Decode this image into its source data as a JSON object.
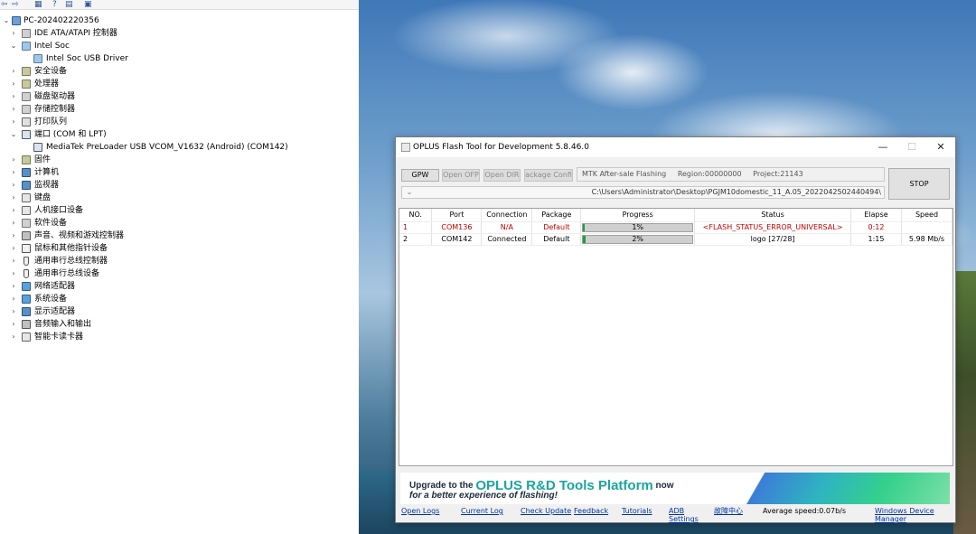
{
  "device_manager": {
    "toolbar": {
      "back": "⇦",
      "forward": "⇨",
      "view_a": "▦",
      "help": "?",
      "view_b": "▤",
      "monitor": "▣"
    },
    "tree": [
      {
        "label": "PC-202402220356",
        "icon": "computer-icon",
        "expanded": true
      },
      {
        "label": "IDE ATA/ATAPI 控制器",
        "icon": "ide-icon"
      },
      {
        "label": "Intel Soc",
        "icon": "usb-icon",
        "expanded": true
      },
      {
        "label": "Intel Soc USB Driver",
        "icon": "usb-driver-icon"
      },
      {
        "label": "安全设备",
        "icon": "security-device-icon"
      },
      {
        "label": "处理器",
        "icon": "processor-icon"
      },
      {
        "label": "磁盘驱动器",
        "icon": "disk-icon"
      },
      {
        "label": "存储控制器",
        "icon": "storage-controller-icon"
      },
      {
        "label": "打印队列",
        "icon": "printer-icon"
      },
      {
        "label": "端口 (COM 和 LPT)",
        "icon": "port-icon",
        "expanded": true
      },
      {
        "label": "MediaTek PreLoader USB VCOM_V1632 (Android) (COM142)",
        "icon": "port-device-icon"
      },
      {
        "label": "固件",
        "icon": "firmware-icon"
      },
      {
        "label": "计算机",
        "icon": "computer-icon"
      },
      {
        "label": "监视器",
        "icon": "monitor-icon"
      },
      {
        "label": "键盘",
        "icon": "keyboard-icon"
      },
      {
        "label": "人机接口设备",
        "icon": "hid-icon"
      },
      {
        "label": "软件设备",
        "icon": "software-device-icon"
      },
      {
        "label": "声音、视频和游戏控制器",
        "icon": "sound-icon"
      },
      {
        "label": "鼠标和其他指针设备",
        "icon": "mouse-icon"
      },
      {
        "label": "通用串行总线控制器",
        "icon": "usb-controller-icon"
      },
      {
        "label": "通用串行总线设备",
        "icon": "usb-device-icon"
      },
      {
        "label": "网络适配器",
        "icon": "network-adapter-icon"
      },
      {
        "label": "系统设备",
        "icon": "system-device-icon"
      },
      {
        "label": "显示适配器",
        "icon": "display-adapter-icon"
      },
      {
        "label": "音频输入和输出",
        "icon": "audio-io-icon"
      },
      {
        "label": "智能卡读卡器",
        "icon": "smartcard-reader-icon"
      }
    ]
  },
  "flash_tool": {
    "title": "OPLUS Flash Tool for Development 5.8.46.0",
    "window_controls": {
      "minimize": "—",
      "maximize": "☐",
      "close": "✕"
    },
    "buttons": {
      "gpw": "GPW",
      "open_ofp": "Open OFP",
      "open_dir": "Open DIR",
      "package_config": "ackage Confi",
      "stop": "STOP"
    },
    "info": {
      "mode": "MTK After-sale Flashing",
      "region": "Region:00000000",
      "project": "Project:21143"
    },
    "path": "C:\\Users\\Administrator\\Desktop\\PGJM10domestic_11_A.05_2022042502440494\\",
    "table": {
      "headers": [
        "NO.",
        "Port",
        "Connection",
        "Package",
        "Progress",
        "Status",
        "Elapse",
        "Speed"
      ],
      "rows": [
        {
          "no": "1",
          "port": "COM136",
          "connection": "N/A",
          "package": "Default",
          "progress_label": "1%",
          "progress": 1,
          "status": "<FLASH_STATUS_ERROR_UNIVERSAL>",
          "elapse": "0:12",
          "speed": "",
          "error": true
        },
        {
          "no": "2",
          "port": "COM142",
          "connection": "Connected",
          "package": "Default",
          "progress_label": "2%",
          "progress": 2,
          "status": "logo [27/28]",
          "elapse": "1:15",
          "speed": "5.98 Mb/s",
          "error": false
        }
      ]
    },
    "banner": {
      "prefix": "Upgrade to the ",
      "brand": "OPLUS R&D Tools Platform",
      "suffix": " now",
      "line2": "for a better experience of flashing!"
    },
    "footer": {
      "open_logs": "Open Logs",
      "current_log": "Current Log",
      "check_update": "Check Update",
      "feedback": "Feedback",
      "tutorials": "Tutorials",
      "adb_settings": "ADB Settings",
      "fault_center": "故障中心",
      "average_speed": "Average speed:0.07b/s",
      "windows_device_manager": "Windows Device Manager"
    },
    "colors": {
      "progress_fill": "#1e9f3a",
      "error_text": "#c00000",
      "brand_text": "#1aa6a0",
      "link": "#0033a0"
    }
  }
}
